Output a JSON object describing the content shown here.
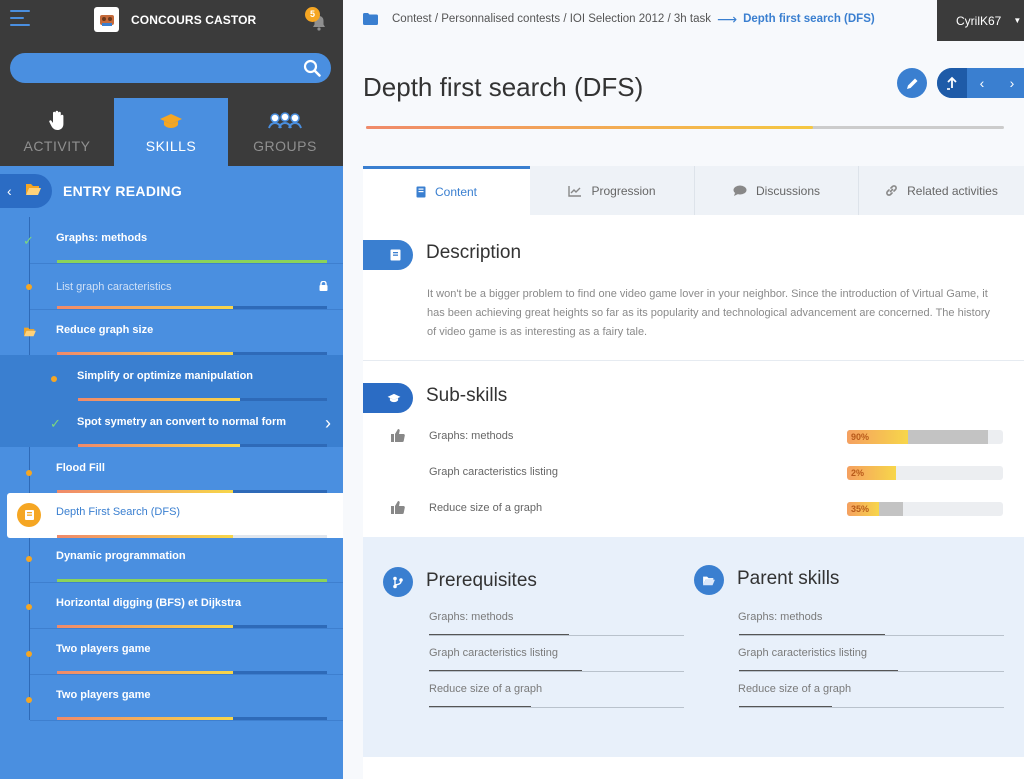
{
  "app": {
    "title": "CONCOURS CASTOR",
    "notifications_count": "5"
  },
  "search": {
    "placeholder": ""
  },
  "mode_tabs": [
    {
      "label": "ACTIVITY",
      "icon": "hand-icon",
      "active": false
    },
    {
      "label": "SKILLS",
      "icon": "graduation-cap-icon",
      "active": true
    },
    {
      "label": "GROUPS",
      "icon": "group-icon",
      "active": false
    }
  ],
  "folder": {
    "title": "ENTRY READING"
  },
  "skills": [
    {
      "label": "Graphs: methods",
      "status": "done",
      "progress": 1.0,
      "style": "green"
    },
    {
      "label": "List graph caracteristics",
      "status": "locked",
      "progress": 0.65,
      "style": "orange"
    },
    {
      "label": "Reduce graph size",
      "status": "folder",
      "progress": 0.65,
      "style": "orange"
    },
    {
      "label": "Simplify or optimize manipulation",
      "status": "todo",
      "progress": 0.65,
      "style": "orange"
    },
    {
      "label": "Spot symetry an convert to normal form",
      "status": "done",
      "progress": 0.65,
      "style": "orange"
    },
    {
      "label": "Flood Fill",
      "status": "todo",
      "progress": 0.65,
      "style": "orange"
    },
    {
      "label": "Depth First Search (DFS)",
      "status": "current",
      "progress": 0.65,
      "style": "orange"
    },
    {
      "label": "Dynamic programmation",
      "status": "todo",
      "progress": 1.0,
      "style": "green"
    },
    {
      "label": "Horizontal digging (BFS) et Dijkstra",
      "status": "todo",
      "progress": 0.65,
      "style": "orange"
    },
    {
      "label": "Two players game",
      "status": "todo",
      "progress": 0.65,
      "style": "orange"
    },
    {
      "label": "Two players game",
      "status": "todo",
      "progress": 0.65,
      "style": "orange"
    }
  ],
  "breadcrumb": {
    "path": "Contest / Personnalised contests / IOI Selection 2012 / 3h task",
    "current": "Depth first search (DFS)"
  },
  "user": {
    "name": "CyrilK67"
  },
  "page": {
    "title": "Depth first search (DFS)",
    "progress": 0.7
  },
  "tabs": [
    {
      "label": "Content",
      "icon": "book-icon",
      "active": true
    },
    {
      "label": "Progression",
      "icon": "chart-icon",
      "active": false
    },
    {
      "label": "Discussions",
      "icon": "chat-icon",
      "active": false
    },
    {
      "label": "Related activities",
      "icon": "link-icon",
      "active": false
    }
  ],
  "description": {
    "title": "Description",
    "text": "It won't be a bigger problem to find one video game lover in your neighbor. Since the introduction of Virtual Game, it has been achieving great heights so far as its popularity and technological advancement are concerned. The history of video game is as interesting as a fairy tale."
  },
  "subskills": {
    "title": "Sub-skills",
    "items": [
      {
        "label": "Graphs: methods",
        "icon": "thumbs-up-icon",
        "percent_label": "90%",
        "score": 0.9
      },
      {
        "label": "Graph caracteristics listing",
        "icon": "moon-icon",
        "percent_label": "2%",
        "score": 0.02
      },
      {
        "label": "Reduce size of a graph",
        "icon": "thumbs-up-icon",
        "percent_label": "35%",
        "score": 0.35
      }
    ]
  },
  "prerequisites": {
    "title": "Prerequisites",
    "items": [
      {
        "label": "Graphs: methods",
        "progress": 0.55
      },
      {
        "label": "Graph caracteristics listing",
        "progress": 0.6
      },
      {
        "label": "Reduce size of a graph",
        "progress": 0.4
      }
    ]
  },
  "parent_skills": {
    "title": "Parent skills",
    "items": [
      {
        "label": "Graphs: methods",
        "progress": 0.55
      },
      {
        "label": "Graph caracteristics listing",
        "progress": 0.6
      },
      {
        "label": "Reduce size of a graph",
        "progress": 0.35
      }
    ]
  },
  "colors": {
    "primary": "#4a8fe0",
    "dark_bar": "#3b3b3b",
    "accent_orange": "#f5a623",
    "progress_green": "#8bd35a"
  }
}
